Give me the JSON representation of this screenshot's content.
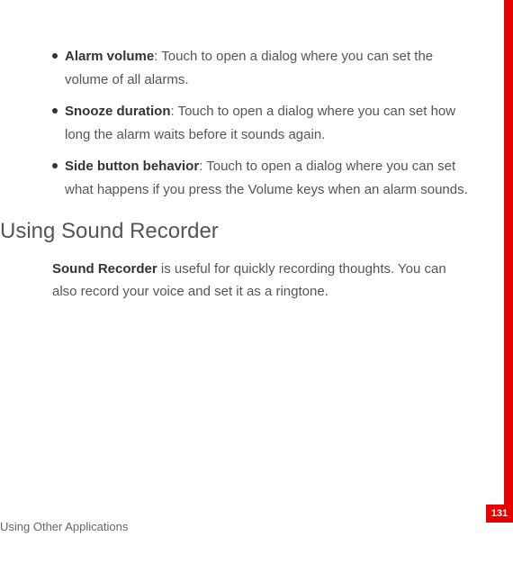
{
  "bullets": [
    {
      "label": "Alarm volume",
      "desc": ": Touch to open a dialog where you can set the volume of all alarms."
    },
    {
      "label": "Snooze duration",
      "desc": ": Touch to open a dialog where you can set how long the alarm waits before it sounds again."
    },
    {
      "label": "Side button behavior",
      "desc": ": Touch to open a dialog where you can set what happens if you press the Volume keys when an alarm sounds."
    }
  ],
  "heading": "Using Sound Recorder",
  "paragraph": {
    "boldPrefix": "Sound Recorder",
    "rest": " is useful for quickly recording thoughts. You can also record your voice and set it as a ringtone."
  },
  "footer": "Using Other Applications",
  "pageNumber": "131",
  "colors": {
    "accent": "#e60000"
  }
}
